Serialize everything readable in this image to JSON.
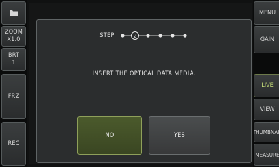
{
  "left_sidebar": {
    "zoom_label": "ZOOM",
    "zoom_value": "X1.0",
    "brightness_label": "BRT",
    "brightness_value": "1",
    "freeze_label": "FRZ",
    "record_label": "REC"
  },
  "right_sidebar": {
    "menu_label": "MENU",
    "gain_label": "GAIN",
    "live_label": "LIVE",
    "view_label": "VIEW",
    "thumbnail_label": "THUMBNAIL",
    "measure_label": "MEASURE"
  },
  "dialog": {
    "step_label": "STEP",
    "current_step": "2",
    "total_steps": 6,
    "message": "INSERT THE OPTICAL DATA MEDIA.",
    "no_label": "NO",
    "yes_label": "YES"
  },
  "colors": {
    "accent_live": "#c8e07a",
    "no_button": "#4b5a2c",
    "yes_button": "#4a4d4e"
  }
}
